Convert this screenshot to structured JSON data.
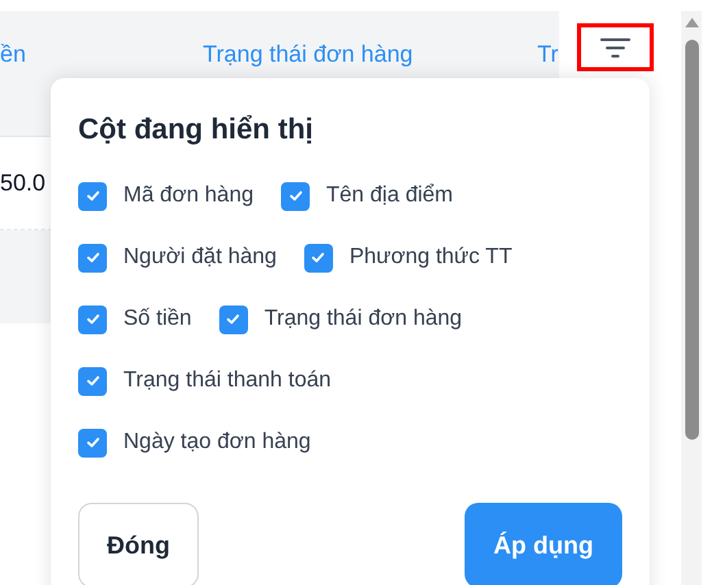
{
  "table": {
    "columns": [
      "ền",
      "Trạng thái đơn hàng",
      "Tr"
    ],
    "rows": [
      {
        "cell": "50.0"
      }
    ]
  },
  "popup": {
    "title": "Cột đang hiển thị",
    "option_rows": [
      [
        {
          "label": "Mã đơn hàng",
          "checked": true
        },
        {
          "label": "Tên địa điểm",
          "checked": true
        }
      ],
      [
        {
          "label": "Người đặt hàng",
          "checked": true
        },
        {
          "label": "Phương thức TT",
          "checked": true
        }
      ],
      [
        {
          "label": "Số tiền",
          "checked": true
        },
        {
          "label": "Trạng thái đơn hàng",
          "checked": true
        }
      ],
      [
        {
          "label": "Trạng thái thanh toán",
          "checked": true
        }
      ],
      [
        {
          "label": "Ngày tạo đơn hàng",
          "checked": true
        }
      ]
    ],
    "buttons": [
      {
        "label": "Đóng",
        "kind": "secondary"
      },
      {
        "label": "Áp dụng",
        "kind": "primary"
      }
    ]
  }
}
